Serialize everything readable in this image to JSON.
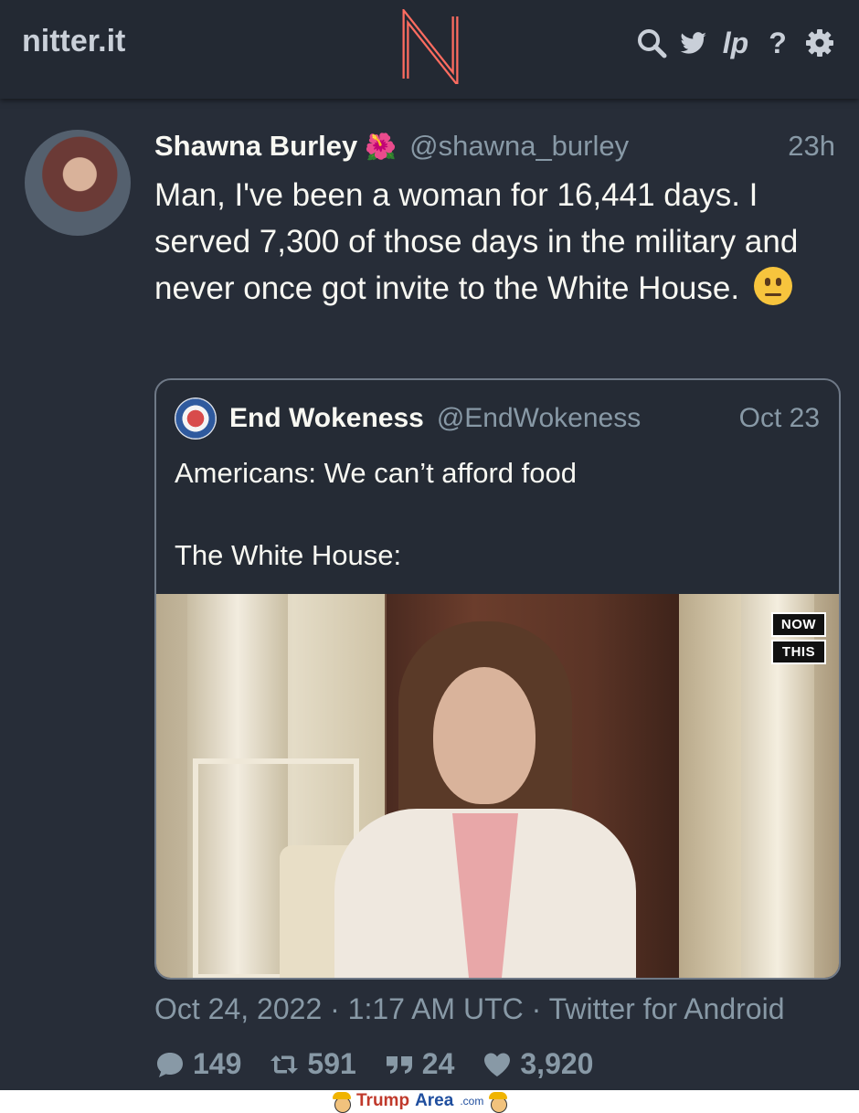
{
  "navbar": {
    "site_name": "nitter.it",
    "logo_letter": "N",
    "icons": [
      "search-icon",
      "twitter-bird-icon",
      "lp-icon",
      "help-icon",
      "settings-gear-icon"
    ],
    "lp_label": "lp",
    "help_label": "?"
  },
  "tweet": {
    "fullname": "Shawna Burley",
    "name_emoji": "🌺",
    "username": "@shawna_burley",
    "relative_time": "23h",
    "text": "Man, I've been a woman for 16,441 days. I served 7,300 of those days in the military and never once got invite to the White House.",
    "date_line": "Oct 24, 2022 · 1:17 AM UTC · Twitter for Android",
    "stats": {
      "replies": "149",
      "retweets": "591",
      "quotes": "24",
      "likes": "3,920"
    }
  },
  "quote": {
    "fullname": "End Wokeness",
    "username": "@EndWokeness",
    "date": "Oct 23",
    "line1": "Americans: We can’t afford food",
    "line2": "The White House:",
    "media_logo_top": "NOW",
    "media_logo_bottom": "THIS"
  },
  "watermark": {
    "trump": "Trump",
    "area": "Area",
    "com": ".com"
  },
  "colors": {
    "background": "#272d38",
    "navbar": "#232933",
    "logo_accent": "#ff6c60",
    "muted_text": "#8899a6"
  }
}
